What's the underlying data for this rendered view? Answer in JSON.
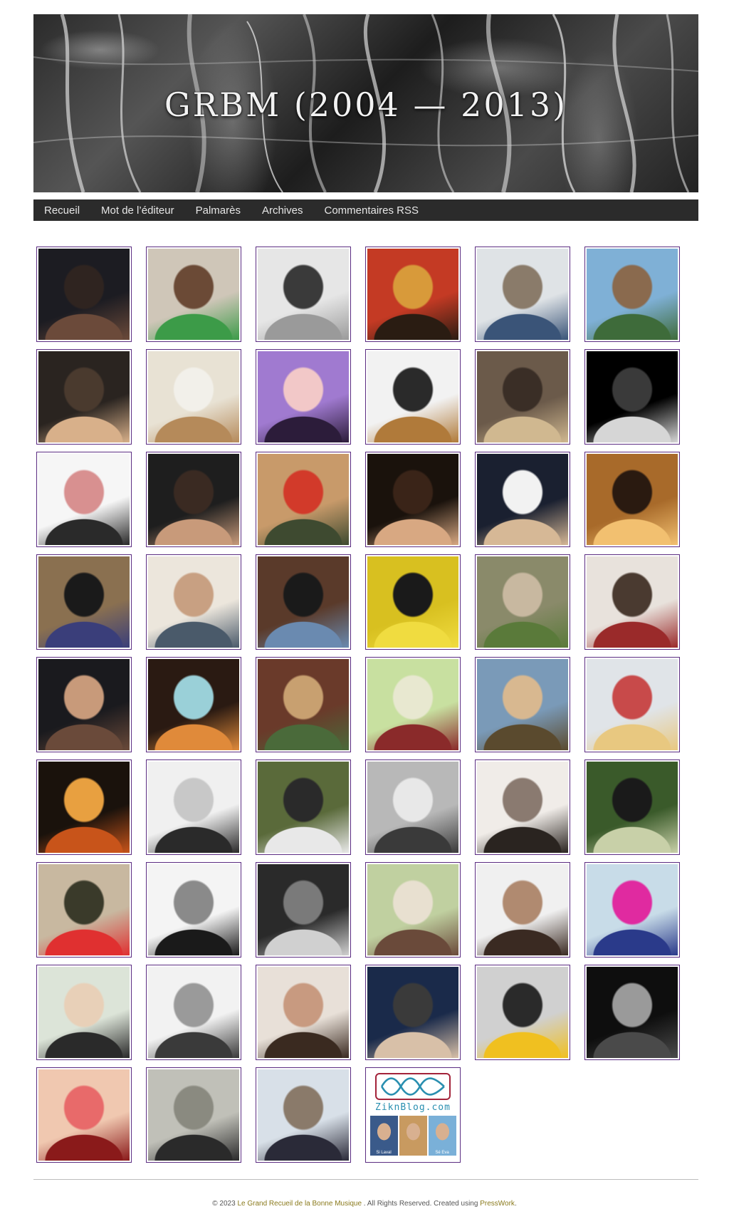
{
  "site": {
    "title": "GRBM (2004 — 2013)"
  },
  "nav": {
    "items": [
      {
        "label": "Recueil"
      },
      {
        "label": "Mot de l’éditeur"
      },
      {
        "label": "Palmarès"
      },
      {
        "label": "Archives"
      },
      {
        "label": "Commentaires RSS"
      }
    ]
  },
  "gallery": {
    "border_color": "#5b2d82",
    "tiles": [
      {
        "name": "avatar-1",
        "colors": [
          "#1c1c22",
          "#6b4a3a",
          "#2f2420"
        ]
      },
      {
        "name": "avatar-2",
        "colors": [
          "#cfc6b8",
          "#3c9b48",
          "#6b4a36"
        ]
      },
      {
        "name": "avatar-3",
        "colors": [
          "#e6e6e6",
          "#9a9a9a",
          "#3a3a3a"
        ]
      },
      {
        "name": "avatar-4",
        "colors": [
          "#c43a24",
          "#2a1c12",
          "#d89a3a"
        ]
      },
      {
        "name": "avatar-5",
        "colors": [
          "#dfe3e6",
          "#3a5478",
          "#8a7b6a"
        ]
      },
      {
        "name": "avatar-6",
        "colors": [
          "#7fb0d6",
          "#3e6b3a",
          "#8a6a4e"
        ]
      },
      {
        "name": "avatar-7",
        "colors": [
          "#2a2420",
          "#d8b08a",
          "#4a3a2e"
        ]
      },
      {
        "name": "avatar-8",
        "colors": [
          "#e8e2d4",
          "#b58a5a",
          "#f2f0ea"
        ]
      },
      {
        "name": "avatar-9",
        "colors": [
          "#a07ad0",
          "#2c1c3a",
          "#f2c8c8"
        ]
      },
      {
        "name": "avatar-10",
        "colors": [
          "#f2f2f2",
          "#b07a3a",
          "#2a2a2a"
        ]
      },
      {
        "name": "avatar-11",
        "colors": [
          "#6b5a4a",
          "#d0b890",
          "#3a2e26"
        ]
      },
      {
        "name": "avatar-12",
        "colors": [
          "#000000",
          "#d6d6d6",
          "#3a3a3a"
        ]
      },
      {
        "name": "avatar-13",
        "colors": [
          "#f6f6f6",
          "#2a2a2a",
          "#d89090"
        ]
      },
      {
        "name": "avatar-14",
        "colors": [
          "#1e1e1e",
          "#c89a7a",
          "#3a2a22"
        ]
      },
      {
        "name": "avatar-15",
        "colors": [
          "#c89a6a",
          "#3e4a30",
          "#d23a2a"
        ]
      },
      {
        "name": "avatar-16",
        "colors": [
          "#1a120c",
          "#d8a882",
          "#3a2418"
        ]
      },
      {
        "name": "avatar-17",
        "colors": [
          "#1a2030",
          "#d6b896",
          "#f2f2f2"
        ]
      },
      {
        "name": "avatar-18",
        "colors": [
          "#a86a2a",
          "#f2c070",
          "#2a1a10"
        ]
      },
      {
        "name": "avatar-19",
        "colors": [
          "#8a7050",
          "#3a3e7a",
          "#1a1a1a"
        ]
      },
      {
        "name": "avatar-20",
        "colors": [
          "#ece6dc",
          "#4a5a6a",
          "#c8a082"
        ]
      },
      {
        "name": "avatar-21",
        "colors": [
          "#5a3a2a",
          "#6a8ab0",
          "#1a1a1a"
        ]
      },
      {
        "name": "avatar-22",
        "colors": [
          "#d8c020",
          "#f0dc40",
          "#1a1a1a"
        ]
      },
      {
        "name": "avatar-23",
        "colors": [
          "#8a8a6a",
          "#5a7a3a",
          "#c8b8a0"
        ]
      },
      {
        "name": "avatar-24",
        "colors": [
          "#e8e2dc",
          "#9a2a2a",
          "#4a3a30"
        ]
      },
      {
        "name": "avatar-25",
        "colors": [
          "#1a1a1e",
          "#6a4a3a",
          "#c89a7a"
        ]
      },
      {
        "name": "avatar-26",
        "colors": [
          "#2a1a12",
          "#e08a3a",
          "#9ad0d8"
        ]
      },
      {
        "name": "avatar-27",
        "colors": [
          "#6a3a2a",
          "#4a6a3a",
          "#c8a070"
        ]
      },
      {
        "name": "avatar-28",
        "colors": [
          "#c8e0a0",
          "#8a2a2a",
          "#e8e8d0"
        ]
      },
      {
        "name": "avatar-29",
        "colors": [
          "#7a9ab8",
          "#5a4a2e",
          "#d8b890"
        ]
      },
      {
        "name": "avatar-30",
        "colors": [
          "#e0e4e8",
          "#e8c880",
          "#c84a4a"
        ]
      },
      {
        "name": "avatar-31",
        "colors": [
          "#1a120c",
          "#c8541a",
          "#e8a040"
        ]
      },
      {
        "name": "avatar-32",
        "colors": [
          "#f0f0f0",
          "#2a2a2a",
          "#c8c8c8"
        ]
      },
      {
        "name": "avatar-33",
        "colors": [
          "#5a6a3a",
          "#e8e8e8",
          "#2a2a2a"
        ]
      },
      {
        "name": "avatar-34",
        "colors": [
          "#b8b8b8",
          "#3a3a3a",
          "#e8e8e8"
        ]
      },
      {
        "name": "avatar-35",
        "colors": [
          "#f0ece8",
          "#2a2420",
          "#8a7a70"
        ]
      },
      {
        "name": "avatar-36",
        "colors": [
          "#3a5a2a",
          "#c8d0a8",
          "#1a1a1a"
        ]
      },
      {
        "name": "avatar-37",
        "colors": [
          "#c8b8a0",
          "#e03030",
          "#3a3a2a"
        ]
      },
      {
        "name": "avatar-38",
        "colors": [
          "#f4f4f4",
          "#1a1a1a",
          "#8a8a8a"
        ]
      },
      {
        "name": "avatar-39",
        "colors": [
          "#2a2a2a",
          "#d0d0d0",
          "#7a7a7a"
        ]
      },
      {
        "name": "avatar-40",
        "colors": [
          "#c0d0a0",
          "#6a4a3a",
          "#e8e0d0"
        ]
      },
      {
        "name": "avatar-41",
        "colors": [
          "#f0f0f0",
          "#3a2a22",
          "#b08a70"
        ]
      },
      {
        "name": "avatar-42",
        "colors": [
          "#c8dce8",
          "#2a3a8a",
          "#e02aa0"
        ]
      },
      {
        "name": "avatar-43",
        "colors": [
          "#dce4d8",
          "#2a2a2a",
          "#e8d0b8"
        ]
      },
      {
        "name": "avatar-44",
        "colors": [
          "#f2f2f2",
          "#3a3a3a",
          "#9a9a9a"
        ]
      },
      {
        "name": "avatar-45",
        "colors": [
          "#e8e0d8",
          "#3a2a20",
          "#c89a80"
        ]
      },
      {
        "name": "avatar-46",
        "colors": [
          "#1a2a4a",
          "#d8c0a8",
          "#3a3a3a"
        ]
      },
      {
        "name": "avatar-47",
        "colors": [
          "#d0d0d0",
          "#f0c020",
          "#2a2a2a"
        ]
      },
      {
        "name": "avatar-48",
        "colors": [
          "#0e0e0e",
          "#4a4a4a",
          "#9a9a9a"
        ]
      },
      {
        "name": "avatar-49",
        "colors": [
          "#f0c8b0",
          "#8a1a1a",
          "#e86a6a"
        ]
      },
      {
        "name": "avatar-50",
        "colors": [
          "#c0c0b8",
          "#2a2a2a",
          "#8a8a80"
        ]
      },
      {
        "name": "avatar-51",
        "colors": [
          "#d8e0e8",
          "#2a2a38",
          "#8a7a6a"
        ]
      }
    ],
    "zikn": {
      "text": "ZiknBlog.com",
      "thumbs": [
        {
          "caption": "Si Laval",
          "color": "#3a5a8a"
        },
        {
          "caption": "",
          "color": "#c89a60"
        },
        {
          "caption": "Sé Eva",
          "color": "#7ab0d8"
        }
      ]
    }
  },
  "footer": {
    "prefix": "© 2023",
    "site_link": "Le Grand Recueil de la Bonne Musique",
    "middle": ". All Rights Reserved. Created using",
    "theme_link": "PressWork",
    "suffix": "."
  }
}
